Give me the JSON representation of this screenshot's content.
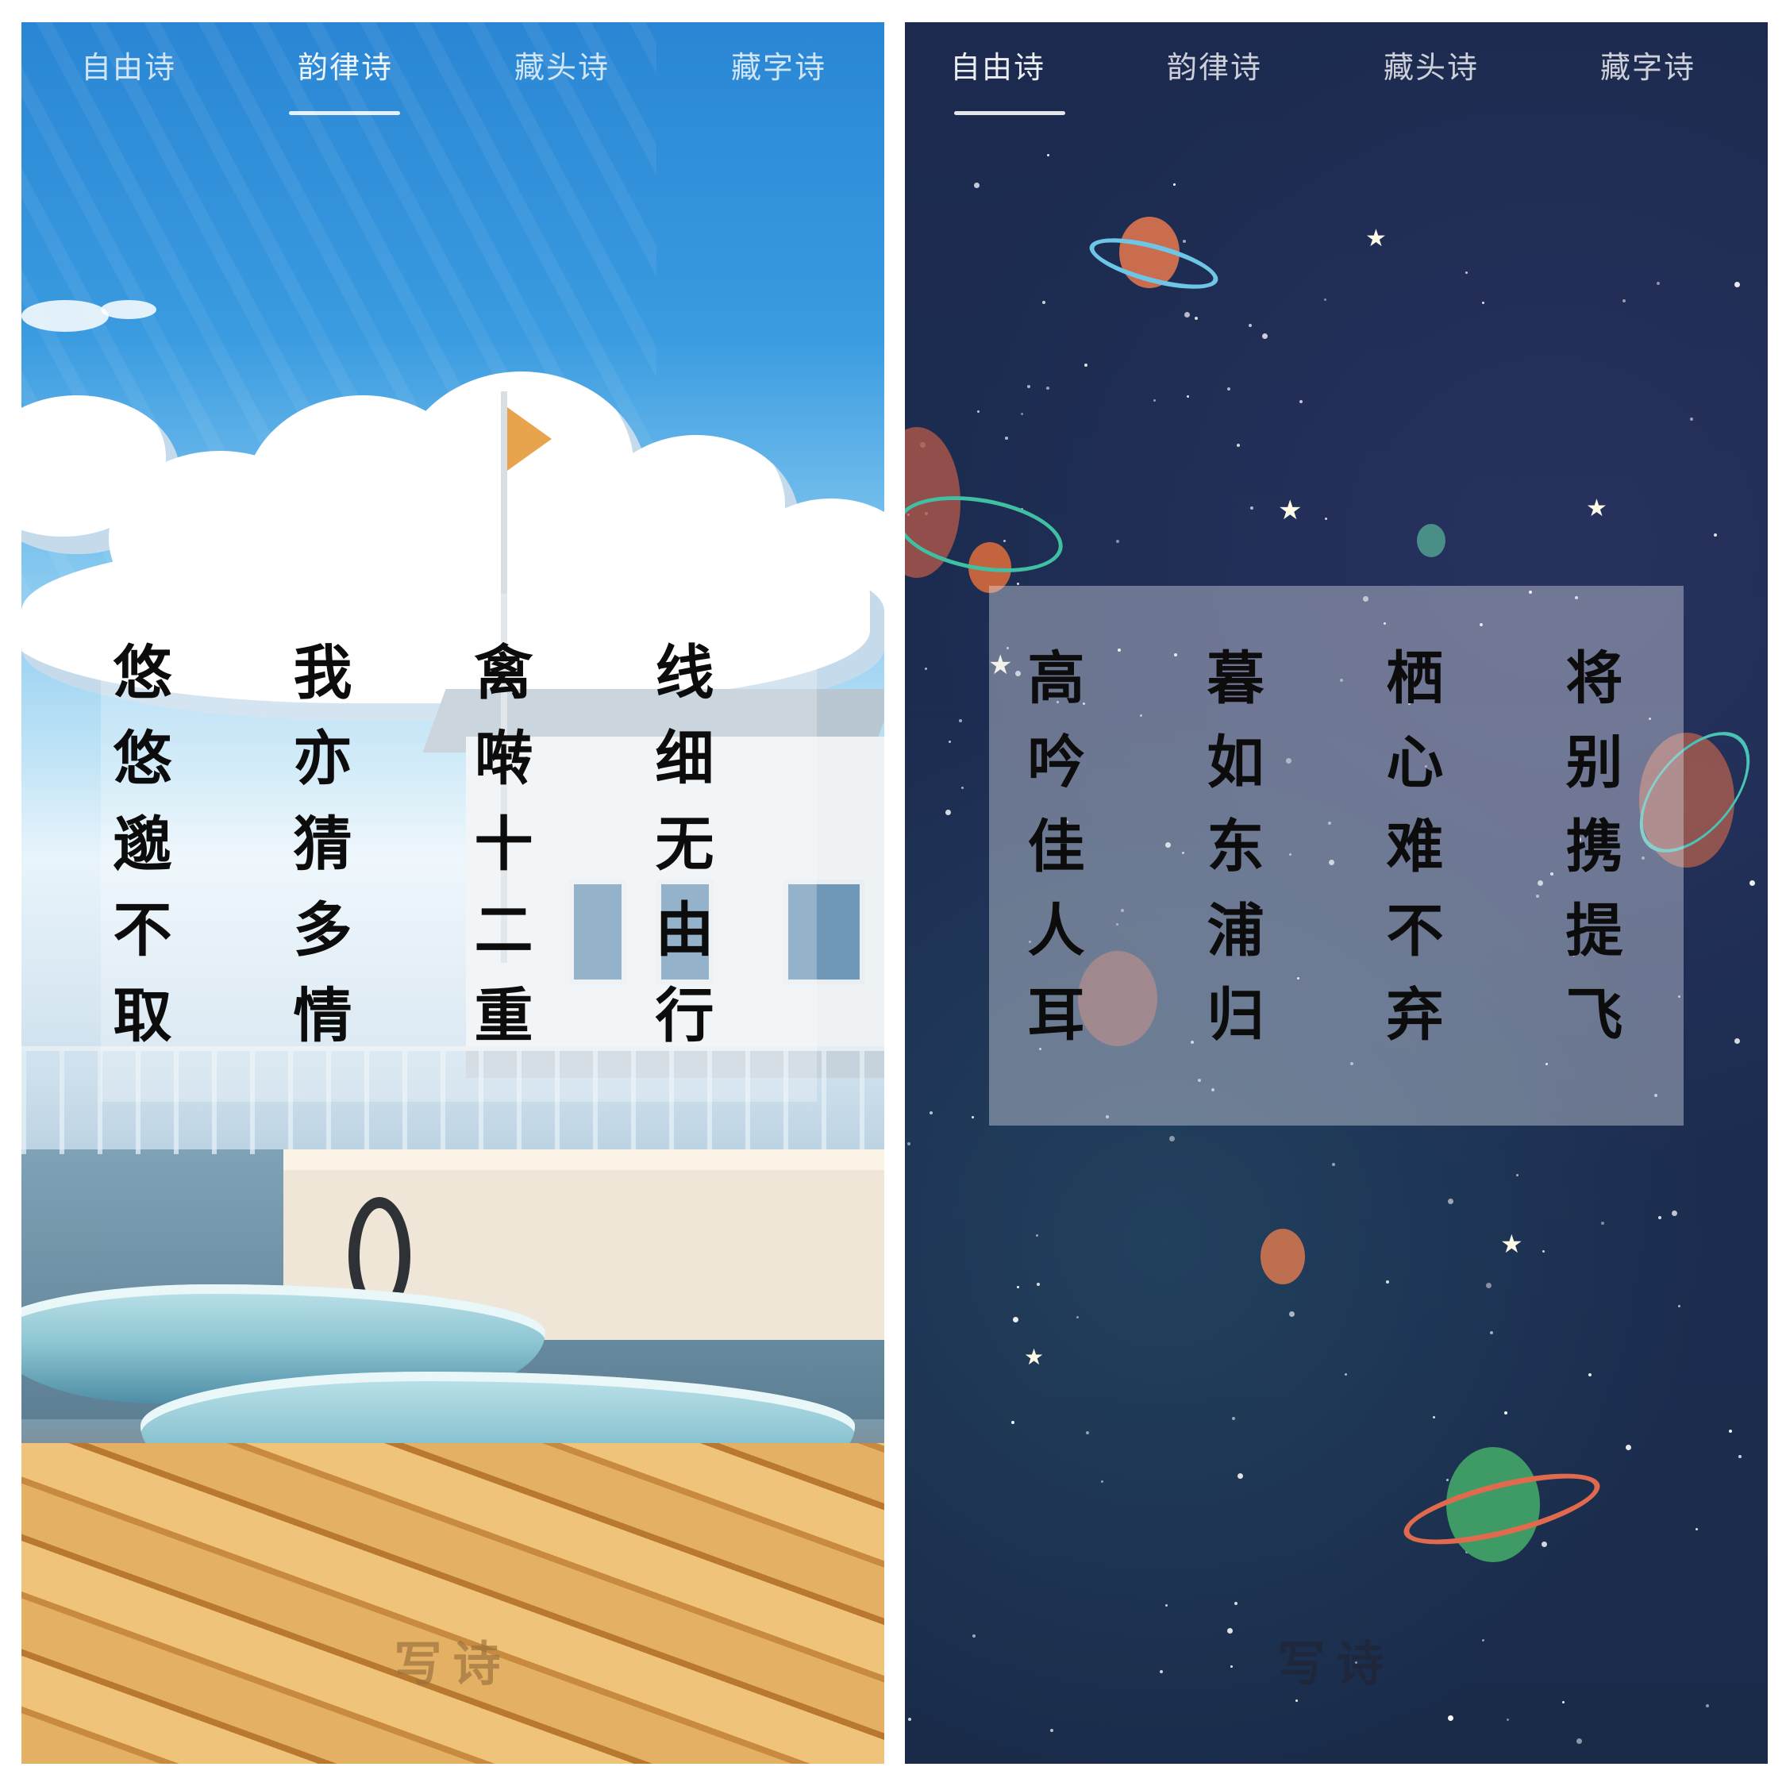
{
  "screens": [
    {
      "id": "left",
      "theme": "seaside-dock",
      "tabs": [
        {
          "label": "自由诗"
        },
        {
          "label": "韵律诗"
        },
        {
          "label": "藏头诗"
        },
        {
          "label": "藏字诗"
        }
      ],
      "active_tab_index": 1,
      "poem_columns": [
        "悠悠邈不取",
        "我亦猜多情",
        "禽啭十二重",
        "线细无由行"
      ],
      "write_button_label": "写诗"
    },
    {
      "id": "right",
      "theme": "starry-night",
      "tabs": [
        {
          "label": "自由诗"
        },
        {
          "label": "韵律诗"
        },
        {
          "label": "藏头诗"
        },
        {
          "label": "藏字诗"
        }
      ],
      "active_tab_index": 0,
      "poem_columns": [
        "高吟佳人耳",
        "暮如东浦归",
        "栖心难不弃",
        "将别携提飞"
      ],
      "write_button_label": "写诗"
    }
  ],
  "colors": {
    "left_sky": "#2a86d4",
    "right_sky": "#1b2a4e",
    "poem_text": "#0c0c0c",
    "tab_text": "#ffffff"
  }
}
